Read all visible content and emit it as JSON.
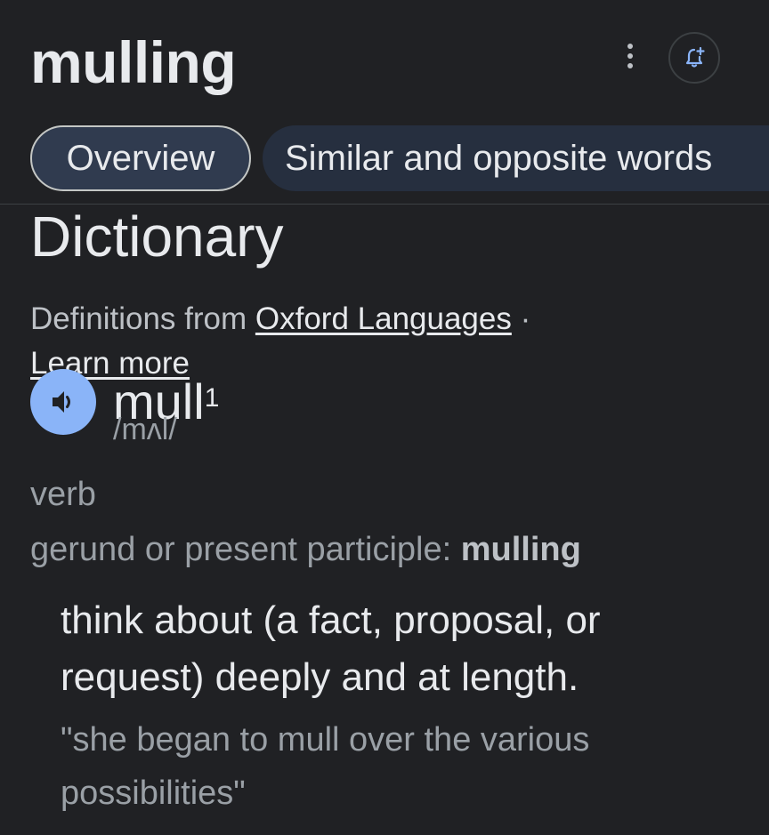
{
  "search": {
    "query": "mulling"
  },
  "tabs": [
    {
      "label": "Overview",
      "selected": true
    },
    {
      "label": "Similar and opposite words",
      "selected": false
    }
  ],
  "dictionary": {
    "title": "Dictionary",
    "source_prefix": "Definitions from",
    "source_link": "Oxford Languages",
    "separator": "·",
    "learn_more": "Learn more",
    "headword": "mull",
    "homograph_number": "1",
    "phonetic": "/mʌl/",
    "part_of_speech": "verb",
    "inflection_label": "gerund or present participle:",
    "inflection_value": "mulling",
    "definition": "think about (a fact, proposal, or request) deeply and at length.",
    "example": "\"she began to mull over the various possibilities\""
  },
  "icons": {
    "more": "more-vertical-icon",
    "alert": "add-alert-icon",
    "audio": "speaker-icon"
  },
  "colors": {
    "background": "#202124",
    "accent": "#8ab4f8",
    "chip_selected": "#303b4f",
    "chip": "#262f3f"
  }
}
